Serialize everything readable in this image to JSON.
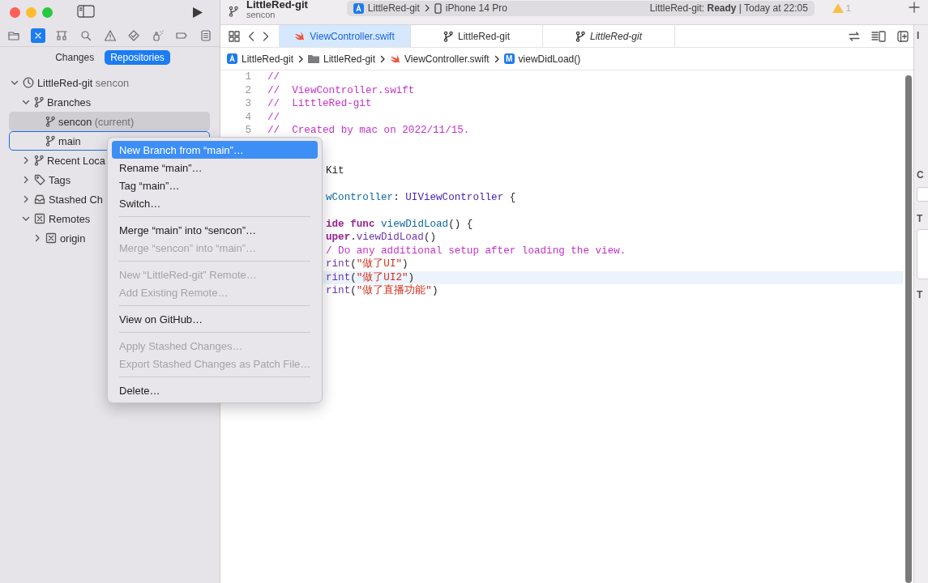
{
  "toolbar": {
    "project": "LittleRed-git",
    "branch": "sencon",
    "scheme": "LittleRed-git",
    "destination": "iPhone 14 Pro",
    "status": "LittleRed-git: **Ready** | Today at 22:05",
    "warnings": "1"
  },
  "navigator": {
    "icons": [
      {
        "kind": "folder",
        "selected": false
      },
      {
        "kind": "source-control",
        "selected": true
      },
      {
        "kind": "hierarchy",
        "selected": false
      },
      {
        "kind": "search",
        "selected": false
      },
      {
        "kind": "warning",
        "selected": false
      },
      {
        "kind": "test",
        "selected": false
      },
      {
        "kind": "debug",
        "selected": false
      },
      {
        "kind": "breakpoint",
        "selected": false
      },
      {
        "kind": "report",
        "selected": false
      }
    ],
    "segments": [
      {
        "label": "Changes",
        "selected": false
      },
      {
        "label": "Repositories",
        "selected": true
      }
    ],
    "tree": [
      {
        "kind": "repo",
        "label": "LittleRed-git",
        "detail": "sencon",
        "expanded": true,
        "children": [
          {
            "kind": "branch-group",
            "label": "Branches",
            "expanded": true,
            "children": [
              {
                "kind": "branch",
                "label": "sencon",
                "detail": "(current)",
                "selected": true,
                "focused": false
              },
              {
                "kind": "branch",
                "label": "main",
                "selected": false,
                "focused": true
              }
            ]
          },
          {
            "kind": "branch-group",
            "label": "Recent Loca",
            "expanded": false
          },
          {
            "kind": "tag-group",
            "label": "Tags",
            "expanded": false
          },
          {
            "kind": "stash-group",
            "label": "Stashed Ch",
            "expanded": false
          },
          {
            "kind": "remote-group",
            "label": "Remotes",
            "expanded": true,
            "children": [
              {
                "kind": "remote",
                "label": "origin",
                "expanded": false
              }
            ]
          }
        ]
      }
    ]
  },
  "tabs": [
    {
      "kind": "file",
      "label": "ViewController.swift",
      "selected": true,
      "italic": false
    },
    {
      "kind": "branch",
      "label": "LittleRed-git",
      "selected": false,
      "italic": false
    },
    {
      "kind": "branch",
      "label": "LittleRed-git",
      "selected": false,
      "italic": true
    }
  ],
  "breadcrumb": [
    {
      "kind": "project",
      "label": "LittleRed-git"
    },
    {
      "kind": "folder",
      "label": "LittleRed-git"
    },
    {
      "kind": "swift",
      "label": "ViewController.swift"
    },
    {
      "kind": "method",
      "label": "viewDidLoad()",
      "badge": "M"
    }
  ],
  "code": {
    "lines": [
      {
        "kind": "full",
        "number": "1",
        "tokens": [
          {
            "kind": "comment",
            "s": "//"
          }
        ]
      },
      {
        "kind": "full",
        "number": "2",
        "tokens": [
          {
            "kind": "comment",
            "s": "//  ViewController.swift"
          }
        ]
      },
      {
        "kind": "full",
        "number": "3",
        "tokens": [
          {
            "kind": "comment",
            "s": "//  LittleRed-git"
          }
        ]
      },
      {
        "kind": "full",
        "number": "4",
        "tokens": [
          {
            "kind": "comment",
            "s": "//"
          }
        ]
      },
      {
        "kind": "full",
        "number": "5",
        "tokens": [
          {
            "kind": "comment",
            "s": "//  Created by mac on 2022/11/15."
          }
        ]
      },
      {
        "kind": "blank"
      },
      {
        "kind": "blank"
      },
      {
        "kind": "covered",
        "tokens": [
          {
            "kind": "plain",
            "s": "Kit"
          }
        ]
      },
      {
        "kind": "blank"
      },
      {
        "kind": "covered",
        "tokens": [
          {
            "kind": "decl",
            "s": "wController"
          },
          {
            "kind": "plain",
            "s": ": "
          },
          {
            "kind": "type",
            "s": "UIViewController"
          },
          {
            "kind": "plain",
            "s": " {"
          }
        ]
      },
      {
        "kind": "blank"
      },
      {
        "kind": "covered",
        "tokens": [
          {
            "kind": "keyword",
            "s": "ide"
          },
          {
            "kind": "keyword",
            "s": " func"
          },
          {
            "kind": "decl",
            "s": " viewDidLoad"
          },
          {
            "kind": "plain",
            "s": "() {"
          }
        ]
      },
      {
        "kind": "covered",
        "tokens": [
          {
            "kind": "keyword",
            "s": "uper"
          },
          {
            "kind": "plain",
            "s": "."
          },
          {
            "kind": "call",
            "s": "viewDidLoad"
          },
          {
            "kind": "plain",
            "s": "()"
          }
        ]
      },
      {
        "kind": "covered",
        "tokens": [
          {
            "kind": "comment",
            "s": "/ Do any additional setup after loading the view."
          }
        ]
      },
      {
        "kind": "covered",
        "tokens": [
          {
            "kind": "call",
            "s": "rint"
          },
          {
            "kind": "plain",
            "s": "("
          },
          {
            "kind": "string",
            "s": "\"做了UI\""
          },
          {
            "kind": "plain",
            "s": ")"
          }
        ]
      },
      {
        "kind": "covered",
        "current": true,
        "tokens": [
          {
            "kind": "call",
            "s": "rint"
          },
          {
            "kind": "plain",
            "s": "("
          },
          {
            "kind": "string",
            "s": "\"做了UI2\""
          },
          {
            "kind": "plain",
            "s": ")"
          }
        ]
      },
      {
        "kind": "covered",
        "tokens": [
          {
            "kind": "call",
            "s": "rint"
          },
          {
            "kind": "plain",
            "s": "("
          },
          {
            "kind": "string",
            "s": "\"做了直播功能\""
          },
          {
            "kind": "plain",
            "s": ")"
          }
        ]
      }
    ]
  },
  "context_menu": [
    {
      "kind": "item",
      "label": "New Branch from “main”…",
      "highlighted": true,
      "disabled": false
    },
    {
      "kind": "item",
      "label": "Rename “main”…",
      "highlighted": false,
      "disabled": false
    },
    {
      "kind": "item",
      "label": "Tag “main”…",
      "highlighted": false,
      "disabled": false
    },
    {
      "kind": "item",
      "label": "Switch…",
      "highlighted": false,
      "disabled": false
    },
    {
      "kind": "separator"
    },
    {
      "kind": "item",
      "label": "Merge “main” into “sencon”…",
      "highlighted": false,
      "disabled": false
    },
    {
      "kind": "item",
      "label": "Merge “sencon” into “main”…",
      "highlighted": false,
      "disabled": true
    },
    {
      "kind": "separator"
    },
    {
      "kind": "item",
      "label": "New “LittleRed-git” Remote…",
      "highlighted": false,
      "disabled": true
    },
    {
      "kind": "item",
      "label": "Add Existing Remote…",
      "highlighted": false,
      "disabled": true
    },
    {
      "kind": "separator"
    },
    {
      "kind": "item",
      "label": "View on GitHub…",
      "highlighted": false,
      "disabled": false
    },
    {
      "kind": "separator"
    },
    {
      "kind": "item",
      "label": "Apply Stashed Changes…",
      "highlighted": false,
      "disabled": true
    },
    {
      "kind": "item",
      "label": "Export Stashed Changes as Patch File…",
      "highlighted": false,
      "disabled": true
    },
    {
      "kind": "separator"
    },
    {
      "kind": "item",
      "label": "Delete…",
      "highlighted": false,
      "disabled": false
    }
  ],
  "inspector": {
    "labels": [
      "I",
      "C",
      "T",
      "T"
    ]
  }
}
